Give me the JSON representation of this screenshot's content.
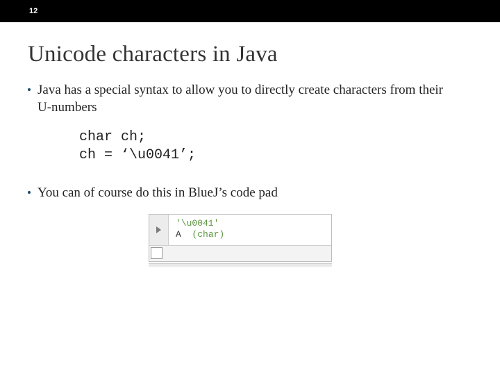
{
  "slide_number": "12",
  "title": "Unicode characters in Java",
  "bullet1": "Java has a special syntax to allow you to directly create characters from their U-numbers",
  "code_line1": "char ch;",
  "code_line2": "ch = ‘\\u0041’;",
  "bullet2": "You can of course do this in BlueJ’s code pad",
  "screenshot": {
    "expr": "'\\u0041'",
    "result_value": "A",
    "result_type": "(char)"
  }
}
